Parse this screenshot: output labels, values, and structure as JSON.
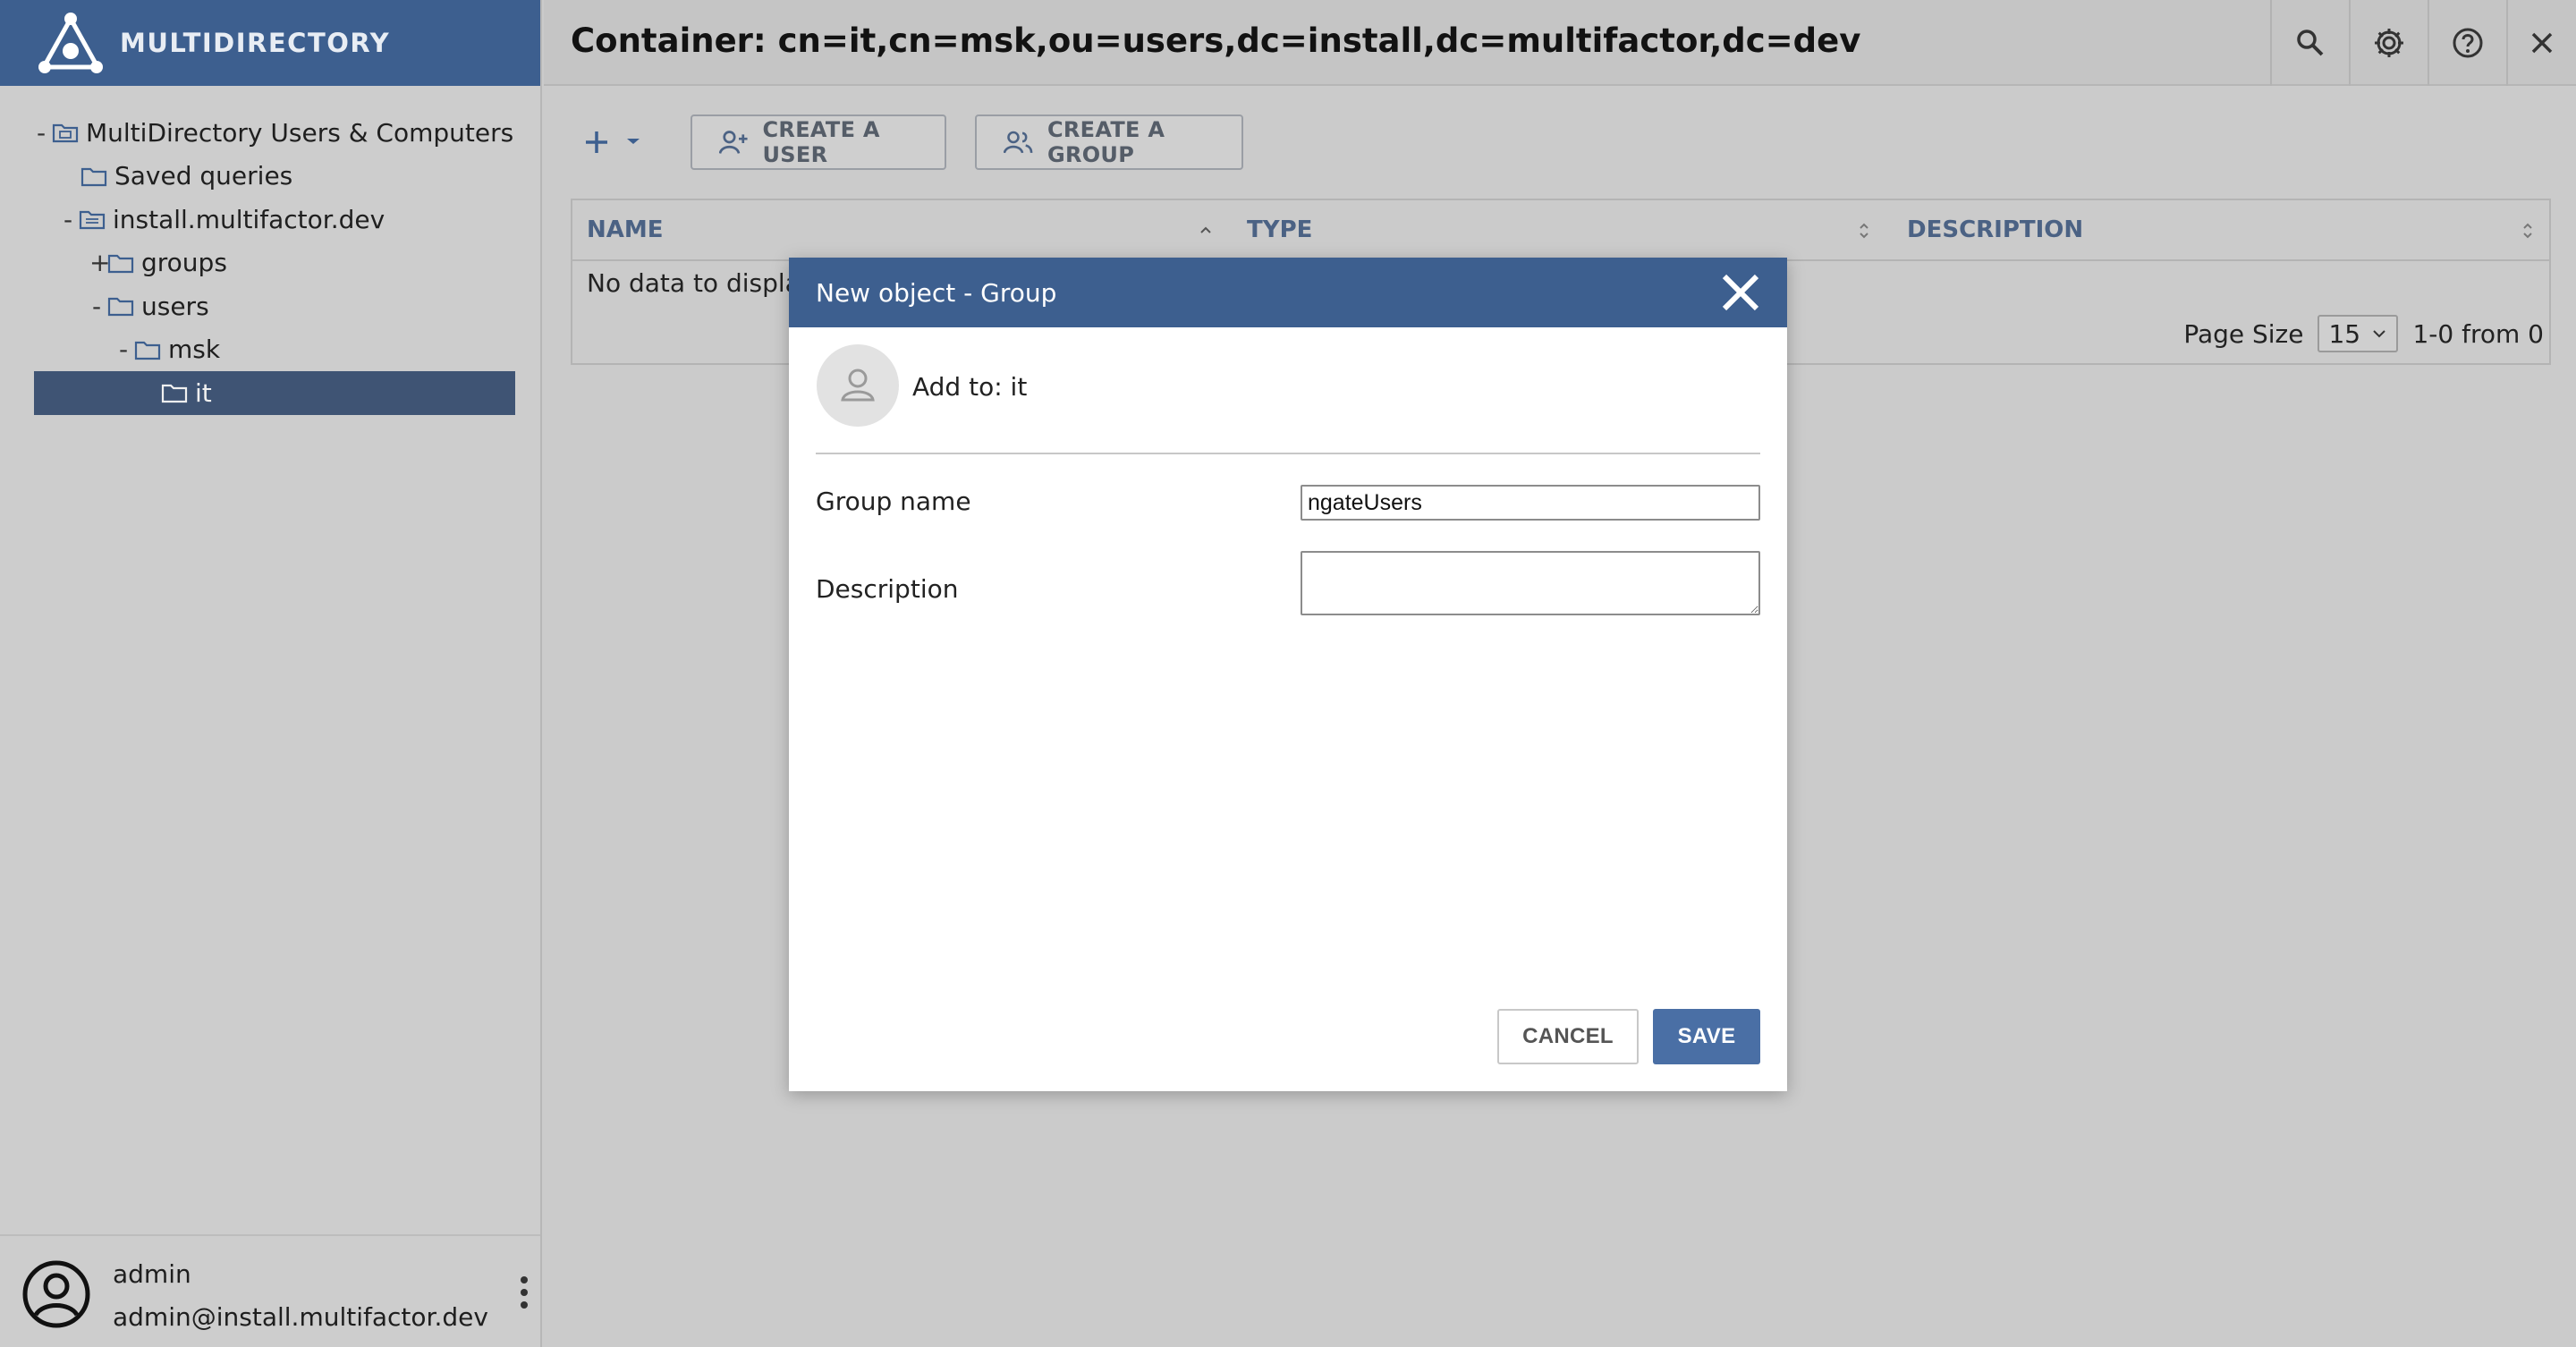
{
  "brand": {
    "name": "MULTIDIRECTORY"
  },
  "tree": [
    {
      "toggle": "-",
      "label": "MultiDirectory Users & Computers",
      "icon": "directory-root-icon"
    },
    {
      "toggle": "",
      "label": "Saved queries",
      "icon": "folder-icon"
    },
    {
      "toggle": "-",
      "label": "install.multifactor.dev",
      "icon": "domain-icon"
    },
    {
      "toggle": "+",
      "label": "groups",
      "icon": "folder-icon"
    },
    {
      "toggle": "-",
      "label": "users",
      "icon": "folder-icon"
    },
    {
      "toggle": "-",
      "label": "msk",
      "icon": "folder-icon"
    },
    {
      "toggle": "",
      "label": "it",
      "icon": "folder-icon"
    }
  ],
  "user": {
    "name": "admin",
    "email": "admin@install.multifactor.dev"
  },
  "header": {
    "title": "Container: cn=it,cn=msk,ou=users,dc=install,dc=multifactor,dc=dev"
  },
  "toolbar": {
    "create_user": "CREATE A USER",
    "create_group": "CREATE A GROUP"
  },
  "grid": {
    "columns": [
      "NAME",
      "TYPE",
      "DESCRIPTION"
    ],
    "empty_text": "No data to display",
    "page_size_label": "Page Size",
    "page_size": "15",
    "range": "1-0 from 0"
  },
  "modal": {
    "title": "New object - Group",
    "add_to": "Add to: it",
    "group_name_label": "Group name",
    "group_name_value": "ngateUsers",
    "description_label": "Description",
    "description_value": "",
    "cancel": "CANCEL",
    "save": "SAVE"
  },
  "colors": {
    "accent": "#3d5f8f",
    "selected": "#3f5474",
    "primary_button": "#4a6fa5"
  }
}
